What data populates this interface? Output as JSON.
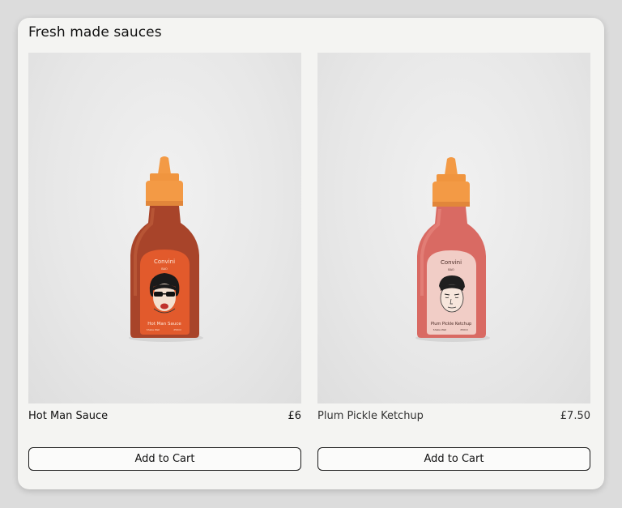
{
  "section": {
    "title": "Fresh made sauces"
  },
  "colors": {
    "cap": "#f39a45",
    "hot_sauce": "#a8442a",
    "hot_label": "#e25a2c",
    "ketchup": "#d96a63",
    "ketchup_label": "#f1cdc6"
  },
  "products": [
    {
      "name": "Hot Man Sauce",
      "price": "£6",
      "cart_label": "Add to Cart",
      "bottle": {
        "brand": "Convini",
        "brand_sub": "BAO",
        "label": "Hot Man Sauce",
        "footer_left": "Shake Well",
        "footer_right": "250ml"
      }
    },
    {
      "name": "Plum Pickle Ketchup",
      "price": "£7.50",
      "cart_label": "Add to Cart",
      "bottle": {
        "brand": "Convini",
        "brand_sub": "BAO",
        "label": "Plum Pickle Ketchup",
        "footer_left": "Shake Well",
        "footer_right": "250ml"
      }
    }
  ]
}
